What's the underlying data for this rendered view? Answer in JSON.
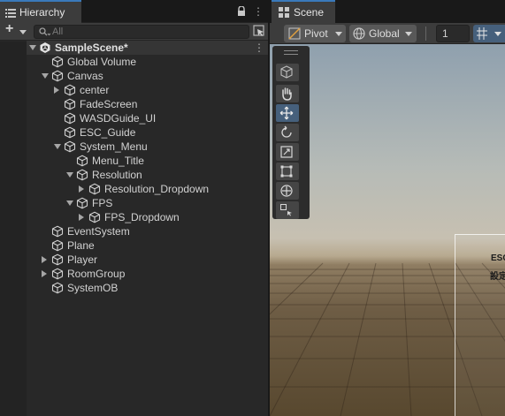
{
  "hierarchy": {
    "tab_label": "Hierarchy",
    "search_placeholder": "All",
    "add_label": "+",
    "more_label": "⋮",
    "items": [
      {
        "label": "SampleScene*",
        "depth": 0,
        "expand": "down",
        "kind": "scene"
      },
      {
        "label": "Global Volume",
        "depth": 1,
        "expand": "none",
        "kind": "object"
      },
      {
        "label": "Canvas",
        "depth": 1,
        "expand": "down",
        "kind": "object"
      },
      {
        "label": "center",
        "depth": 2,
        "expand": "right",
        "kind": "object"
      },
      {
        "label": "FadeScreen",
        "depth": 2,
        "expand": "none",
        "kind": "object"
      },
      {
        "label": "WASDGuide_UI",
        "depth": 2,
        "expand": "none",
        "kind": "object"
      },
      {
        "label": "ESC_Guide",
        "depth": 2,
        "expand": "none",
        "kind": "object"
      },
      {
        "label": "System_Menu",
        "depth": 2,
        "expand": "down",
        "kind": "object"
      },
      {
        "label": "Menu_Title",
        "depth": 3,
        "expand": "none",
        "kind": "object"
      },
      {
        "label": "Resolution",
        "depth": 3,
        "expand": "down",
        "kind": "object"
      },
      {
        "label": "Resolution_Dropdown",
        "depth": 4,
        "expand": "right",
        "kind": "object"
      },
      {
        "label": "FPS",
        "depth": 3,
        "expand": "down",
        "kind": "object"
      },
      {
        "label": "FPS_Dropdown",
        "depth": 4,
        "expand": "right",
        "kind": "object"
      },
      {
        "label": "EventSystem",
        "depth": 1,
        "expand": "none",
        "kind": "object"
      },
      {
        "label": "Plane",
        "depth": 1,
        "expand": "none",
        "kind": "object"
      },
      {
        "label": "Player",
        "depth": 1,
        "expand": "right",
        "kind": "object"
      },
      {
        "label": "RoomGroup",
        "depth": 1,
        "expand": "right",
        "kind": "object"
      },
      {
        "label": "SystemOB",
        "depth": 1,
        "expand": "none",
        "kind": "object"
      }
    ]
  },
  "scene": {
    "tab_label": "Scene",
    "pivot_label": "Pivot",
    "global_label": "Global",
    "grid_size": "1",
    "overlay_text_1": "ESC",
    "overlay_text_2": "設定",
    "tools": [
      "view-tool",
      "hand-tool",
      "move-tool",
      "rotate-tool",
      "scale-tool",
      "rect-tool",
      "transform-tool",
      "custom-tool"
    ],
    "active_tool": "move-tool"
  },
  "colors": {
    "accent": "#3a79bb",
    "active_tool_bg": "#46607c",
    "panel_bg": "#282828"
  }
}
